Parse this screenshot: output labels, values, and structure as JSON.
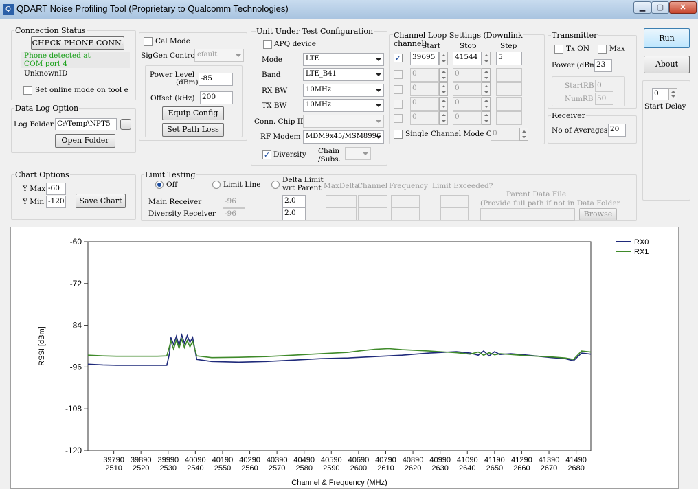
{
  "window": {
    "title": "QDART Noise Profiling Tool (Proprietary to Qualcomm Technologies)",
    "icon": "app-icon",
    "minimize": "▁",
    "maximize": "▢",
    "close": "✕"
  },
  "connection": {
    "title": "Connection Status",
    "check_button": "CHECK PHONE CONN.",
    "status_line1": "Phone detected at",
    "status_line2": "COM port 4",
    "device_id": "UnknownID",
    "online_mode_label": "Set online mode on tool e"
  },
  "calmode": {
    "cal_mode_label": "Cal Mode",
    "siggen_label": "SigGen Control",
    "siggen_value": "efault",
    "power_label_1": "Power Level",
    "power_label_2": "(dBm)",
    "power_value": "-85",
    "offset_label": "Offset (kHz)",
    "offset_value": "200",
    "equip_config_button": "Equip Config",
    "set_path_loss_button": "Set Path Loss"
  },
  "datalog": {
    "title": "Data Log Option",
    "folder_label": "Log Folder",
    "folder_value": "C:\\Temp\\NPT5",
    "open_folder_button": "Open Folder"
  },
  "uut": {
    "title": "Unit Under Test Configuration",
    "apq_label": "APQ device",
    "mode_label": "Mode",
    "mode_value": "LTE",
    "band_label": "Band",
    "band_value": "LTE_B41",
    "rxbw_label": "RX BW",
    "rxbw_value": "10MHz",
    "txbw_label": "TX BW",
    "txbw_value": "10MHz",
    "chip_label": "Conn. Chip ID",
    "rfmodem_label": "RF Modem",
    "rfmodem_value": "MDM9x45/MSM8996",
    "diversity_label": "Diversity",
    "chain_label_1": "Chain",
    "chain_label_2": "/Subs."
  },
  "channel_loop": {
    "title": "Channel Loop Settings (Downlink",
    "subtitle": "channel)",
    "col_start": "Start",
    "col_stop": "Stop",
    "col_step": "Step",
    "rows": [
      {
        "start": "39695",
        "stop": "41544",
        "step": "5"
      },
      {
        "start": "0",
        "stop": "0",
        "step": ""
      },
      {
        "start": "0",
        "stop": "0",
        "step": ""
      },
      {
        "start": "0",
        "stop": "0",
        "step": ""
      },
      {
        "start": "0",
        "stop": "0",
        "step": ""
      }
    ],
    "single_mode_label": "Single Channel Mode C",
    "single_mode_value": "0"
  },
  "transmitter": {
    "title": "Transmitter",
    "txon_label": "Tx ON",
    "max_label": "Max",
    "power_label": "Power (dBm)",
    "power_value": "23",
    "startrb_label": "StartRB",
    "startrb_value": "0",
    "numrb_label": "NumRB",
    "numrb_value": "50"
  },
  "receiver": {
    "title": "Receiver",
    "averages_label": "No of Averages",
    "averages_value": "20"
  },
  "side": {
    "run_button": "Run",
    "about_button": "About",
    "start_delay_value": "0",
    "start_delay_label": "Start Delay"
  },
  "chart_options": {
    "title": "Chart Options",
    "ymax_label": "Y Max",
    "ymax_value": "-60",
    "ymin_label": "Y Min",
    "ymin_value": "-120",
    "save_chart_button": "Save Chart"
  },
  "limit": {
    "title": "Limit Testing",
    "off_label": "Off",
    "limit_line_label": "Limit Line",
    "delta_label_1": "Delta Limit",
    "delta_label_2": "wrt Parent",
    "col_maxdelta": "MaxDelta",
    "col_channel": "Channel",
    "col_frequency": "Frequency",
    "col_exceeded": "Limit Exceeded?",
    "main_rx_label": "Main Receiver",
    "main_rx_value": "-96",
    "main_rx_delta": "2.0",
    "div_rx_label": "Diversity Receiver",
    "div_rx_value": "-96",
    "div_rx_delta": "2.0",
    "parent_title": "Parent Data File",
    "parent_hint": "(Provide full path if not in Data Folder",
    "browse_button": "Browse"
  },
  "chart_data": {
    "type": "line",
    "xlabel": "Channel & Frequency (MHz)",
    "ylabel": "RSSI [dBm]",
    "ylim": [
      -120,
      -60
    ],
    "xlim": [
      39695,
      41544
    ],
    "yticks": [
      -60,
      -72,
      -84,
      -96,
      -108,
      -120
    ],
    "xticks": [
      {
        "ch": "39790",
        "f": "2510"
      },
      {
        "ch": "39890",
        "f": "2520"
      },
      {
        "ch": "39990",
        "f": "2530"
      },
      {
        "ch": "40090",
        "f": "2540"
      },
      {
        "ch": "40190",
        "f": "2550"
      },
      {
        "ch": "40290",
        "f": "2560"
      },
      {
        "ch": "40390",
        "f": "2570"
      },
      {
        "ch": "40490",
        "f": "2580"
      },
      {
        "ch": "40590",
        "f": "2590"
      },
      {
        "ch": "40690",
        "f": "2600"
      },
      {
        "ch": "40790",
        "f": "2610"
      },
      {
        "ch": "40890",
        "f": "2620"
      },
      {
        "ch": "40990",
        "f": "2630"
      },
      {
        "ch": "41090",
        "f": "2640"
      },
      {
        "ch": "41190",
        "f": "2650"
      },
      {
        "ch": "41290",
        "f": "2660"
      },
      {
        "ch": "41390",
        "f": "2670"
      },
      {
        "ch": "41490",
        "f": "2680"
      }
    ],
    "legend_position": "top-right",
    "series": [
      {
        "name": "RX0",
        "color": "#1f2a7a",
        "x": [
          39695,
          39750,
          39800,
          39850,
          39900,
          39950,
          39985,
          39995,
          40000,
          40010,
          40020,
          40030,
          40040,
          40050,
          40060,
          40070,
          40080,
          40095,
          40150,
          40250,
          40350,
          40450,
          40550,
          40650,
          40750,
          40850,
          40950,
          41050,
          41100,
          41130,
          41150,
          41170,
          41190,
          41210,
          41250,
          41300,
          41350,
          41400,
          41450,
          41480,
          41510,
          41544
        ],
        "y": [
          -95.2,
          -95.4,
          -95.5,
          -95.5,
          -95.5,
          -95.5,
          -95.5,
          -92,
          -87.5,
          -89.5,
          -87.2,
          -89.8,
          -86.8,
          -89.2,
          -87.0,
          -88.9,
          -87.5,
          -93.8,
          -94.4,
          -94.6,
          -94.4,
          -94.0,
          -93.6,
          -93.4,
          -93.0,
          -92.6,
          -92.0,
          -91.6,
          -92.0,
          -92.6,
          -91.4,
          -92.8,
          -91.6,
          -92.4,
          -92.2,
          -92.5,
          -92.9,
          -93.3,
          -93.6,
          -94.2,
          -92.0,
          -92.3
        ]
      },
      {
        "name": "RX1",
        "color": "#3f8a2a",
        "x": [
          39695,
          39750,
          39800,
          39850,
          39900,
          39950,
          39985,
          39995,
          40000,
          40010,
          40020,
          40030,
          40040,
          40050,
          40060,
          40070,
          40080,
          40095,
          40150,
          40250,
          40350,
          40450,
          40550,
          40650,
          40700,
          40750,
          40800,
          40850,
          40950,
          41050,
          41100,
          41130,
          41150,
          41170,
          41190,
          41210,
          41250,
          41300,
          41350,
          41400,
          41450,
          41480,
          41510,
          41544
        ],
        "y": [
          -92.6,
          -92.8,
          -92.9,
          -92.9,
          -92.9,
          -92.9,
          -92.8,
          -90,
          -88.5,
          -90.8,
          -88.3,
          -90.6,
          -88.0,
          -90.4,
          -88.4,
          -90.2,
          -88.6,
          -92.8,
          -93.3,
          -93.2,
          -93.0,
          -92.6,
          -92.2,
          -91.8,
          -91.3,
          -90.9,
          -90.7,
          -91.0,
          -91.4,
          -91.9,
          -92.3,
          -91.7,
          -92.6,
          -91.9,
          -92.5,
          -92.2,
          -92.4,
          -92.7,
          -92.9,
          -93.1,
          -93.4,
          -93.8,
          -91.4,
          -91.7
        ]
      }
    ]
  }
}
